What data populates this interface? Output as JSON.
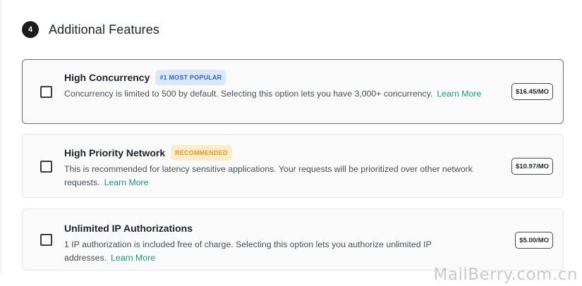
{
  "section": {
    "step_number": "4",
    "title": "Additional Features"
  },
  "features": [
    {
      "title": "High Concurrency",
      "badge": "#1 MOST POPULAR",
      "description": "Concurrency is limited to 500 by default. Selecting this option lets you have 3,000+ concurrency.",
      "link": "Learn More",
      "price": "$16.45/MO",
      "checked": false
    },
    {
      "title": "High Priority Network",
      "badge": "RECOMMENDED",
      "description": "This is recommended for latency sensitive applications. Your requests will be prioritized over other network requests.",
      "link": "Learn More",
      "price": "$10.97/MO",
      "checked": false
    },
    {
      "title": "Unlimited IP Authorizations",
      "description": "1 IP authorization is included free of charge. Selecting this option lets you authorize unlimited IP addresses.",
      "link": "Learn More",
      "price": "$5.00/MO",
      "checked": false
    }
  ],
  "colors": {
    "popular_badge_bg": "#dbe8fb",
    "popular_badge_text": "#2f64c9",
    "recommended_badge_bg": "#fdecc9",
    "recommended_badge_text": "#e29a1e",
    "link": "#179a74"
  },
  "watermark": "MailBerry.com.cn"
}
